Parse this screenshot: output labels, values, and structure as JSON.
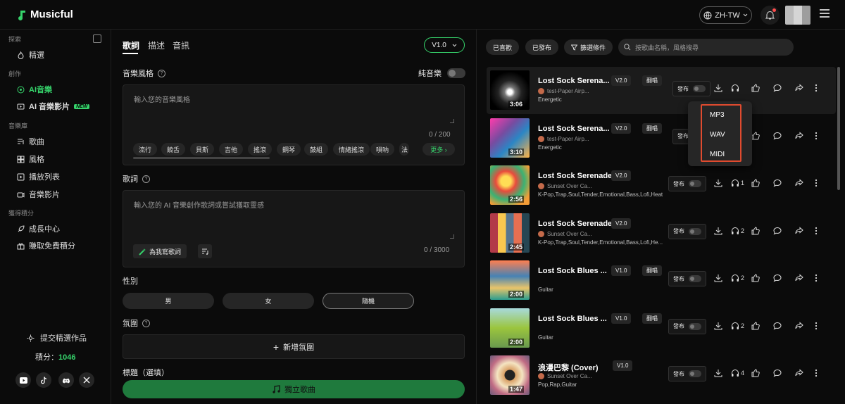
{
  "app": {
    "name": "Musicful"
  },
  "header": {
    "lang": "ZH-TW"
  },
  "sidebar": {
    "explore_label": "探索",
    "featured": "精選",
    "create_label": "創作",
    "ai_music": "AI音樂",
    "ai_video": "AI 音樂影片",
    "new_badge": "NEW",
    "library_label": "音樂庫",
    "songs": "歌曲",
    "styles": "風格",
    "playlists": "播放列表",
    "music_videos": "音樂影片",
    "earn_label": "獲得積分",
    "growth": "成長中心",
    "earn_free": "賺取免費積分",
    "submit_works": "提交精選作品",
    "credits_label": "積分：",
    "credits_value": "1046"
  },
  "create": {
    "tabs": [
      "歌詞",
      "描述",
      "音訊"
    ],
    "version": "V1.0",
    "style_label": "音樂風格",
    "instrumental_label": "純音樂",
    "style_placeholder": "輸入您的音樂風格",
    "style_counter": "0 / 200",
    "chips": [
      "流行",
      "饒舌",
      "貝斯",
      "吉他",
      "搖滾",
      "鋼琴",
      "鼓組",
      "情緒搖滾",
      "嗩吶",
      "法"
    ],
    "more_label": "更多 ›",
    "lyrics_label": "歌詞",
    "lyrics_placeholder": "輸入您的 AI 音樂創作歌詞或嘗試獲取靈感",
    "write_lyrics": "為我寫歌詞",
    "lyrics_counter": "0 / 3000",
    "gender_label": "性別",
    "genders": [
      "男",
      "女",
      "隨機"
    ],
    "mood_label": "氛圍",
    "add_mood": "新增氛圍",
    "title_label": "標題（選填）",
    "create_button": "獨立歌曲"
  },
  "library": {
    "filters": [
      "已喜歡",
      "已發布",
      "篩選條件"
    ],
    "search_placeholder": "按歌曲名稱，風格搜尋",
    "publish_label": "發布",
    "songs": [
      {
        "title": "Lost Sock Serena...",
        "version": "V2.0",
        "cover_badge": "翻唱",
        "artist": "test-Paper Airp...",
        "tags": "Energetic",
        "duration": "3:06",
        "plays": "",
        "likes": ""
      },
      {
        "title": "Lost Sock Serena...",
        "version": "V2.0",
        "cover_badge": "翻唱",
        "artist": "test-Paper Airp...",
        "tags": "Energetic",
        "duration": "3:10",
        "plays": "",
        "likes": ""
      },
      {
        "title": "Lost Sock Serenade",
        "version": "V2.0",
        "cover_badge": "",
        "artist": "Sunset Over Ca...",
        "tags": "K-Pop,Trap,Soul,Tender,Emotional,Bass,Lofi,Heat",
        "duration": "2:56",
        "plays": "1",
        "likes": ""
      },
      {
        "title": "Lost Sock Serenade",
        "version": "V2.0",
        "cover_badge": "",
        "artist": "Sunset Over Ca...",
        "tags": "K-Pop,Trap,Soul,Tender,Emotional,Bass,Lofi,He...",
        "duration": "2:45",
        "plays": "2",
        "likes": ""
      },
      {
        "title": "Lost Sock Blues ...",
        "version": "V1.0",
        "cover_badge": "翻唱",
        "artist": "",
        "tags": "Guitar",
        "duration": "2:00",
        "plays": "2",
        "likes": ""
      },
      {
        "title": "Lost Sock Blues ...",
        "version": "V1.0",
        "cover_badge": "翻唱",
        "artist": "",
        "tags": "Guitar",
        "duration": "2:00",
        "plays": "2",
        "likes": ""
      },
      {
        "title": "浪漫巴黎 (Cover)",
        "version": "V1.0",
        "cover_badge": "",
        "artist": "Sunset Over Ca...",
        "tags": "Pop,Rap,Guitar",
        "duration": "1:47",
        "plays": "4",
        "likes": ""
      }
    ],
    "download_menu": [
      "MP3",
      "WAV",
      "MIDI"
    ]
  },
  "colors": {
    "accent": "#36d36b",
    "highlight_border": "#e04b2f"
  }
}
